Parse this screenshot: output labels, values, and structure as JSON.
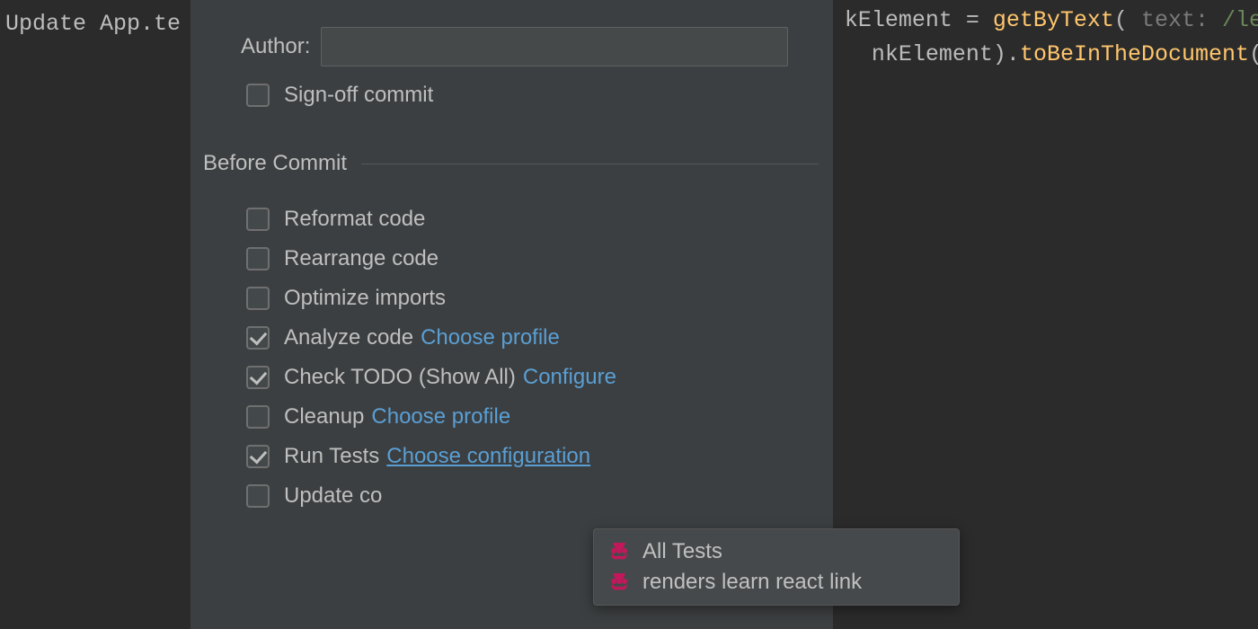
{
  "commit_message": "Update App.te",
  "code": {
    "line1": {
      "id": "kElement",
      "op": " = ",
      "call": "getByText",
      "hint": "text:",
      "regex": "/lea"
    },
    "line2": {
      "id": "nkElement",
      "sep": ").",
      "call": "toBeInTheDocument",
      "tail": "()"
    }
  },
  "author": {
    "label": "Author:",
    "value": ""
  },
  "signoff": {
    "label": "Sign-off commit",
    "checked": false
  },
  "section_title": "Before Commit",
  "checks": {
    "reformat": {
      "label": "Reformat code",
      "checked": false
    },
    "rearrange": {
      "label": "Rearrange code",
      "checked": false
    },
    "optimize": {
      "label": "Optimize imports",
      "checked": false
    },
    "analyze": {
      "label": "Analyze code",
      "checked": true,
      "link": "Choose profile"
    },
    "todo": {
      "label": "Check TODO (Show All)",
      "checked": true,
      "link": "Configure"
    },
    "cleanup": {
      "label": "Cleanup",
      "checked": false,
      "link": "Choose profile"
    },
    "runtests": {
      "label": "Run Tests",
      "checked": true,
      "link": "Choose configuration"
    },
    "update": {
      "label": "Update co",
      "checked": false
    }
  },
  "popup": {
    "items": [
      {
        "label": "All Tests"
      },
      {
        "label": "renders learn react link"
      }
    ]
  }
}
